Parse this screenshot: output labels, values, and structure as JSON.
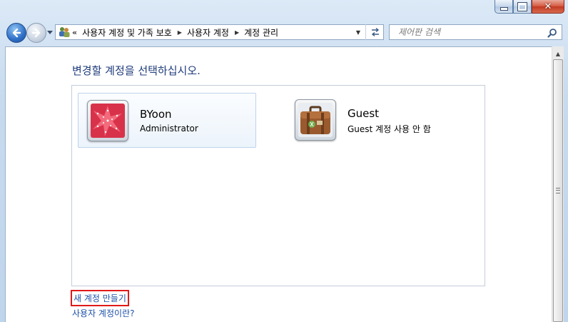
{
  "window": {
    "caption_buttons": [
      "minimize-icon",
      "maximize-icon",
      "close-icon"
    ],
    "accent_color": "#1e3b7a",
    "link_color": "#1e51a8",
    "close_color": "#c13a22"
  },
  "nav": {
    "back_icon": "back-arrow-icon",
    "forward_icon": "forward-arrow-icon",
    "history_icon": "chevron-down-icon"
  },
  "address_bar": {
    "overflow": "«",
    "breadcrumbs": [
      "사용자 계정 및 가족 보호",
      "사용자 계정",
      "계정 관리"
    ],
    "refresh_icon": "refresh-icon"
  },
  "search": {
    "placeholder": "제어판 검색",
    "icon": "search-icon"
  },
  "main": {
    "heading": "변경할 계정을 선택하십시오.",
    "accounts": [
      {
        "name": "BYoon",
        "role": "Administrator",
        "icon": "starfish-avatar-icon",
        "selected": true
      },
      {
        "name": "Guest",
        "role": "Guest 계정 사용 안 함",
        "icon": "suitcase-avatar-icon",
        "selected": false
      }
    ],
    "links": {
      "create_account": "새 계정 만들기",
      "what_is_account": "사용자 계정이란?"
    }
  }
}
